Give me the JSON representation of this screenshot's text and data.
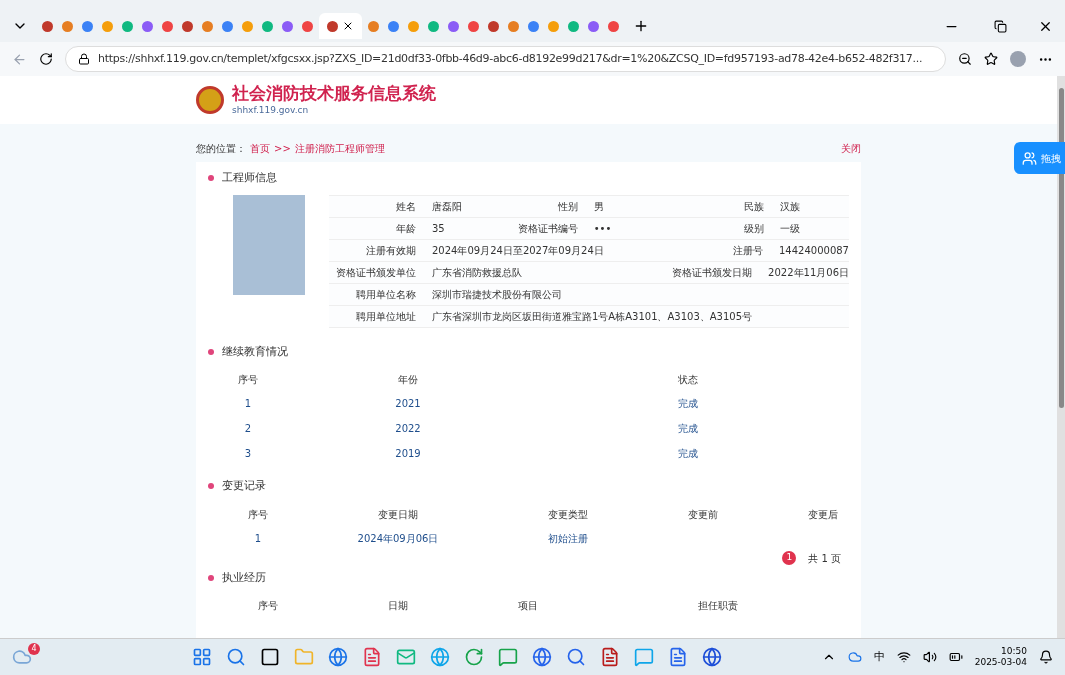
{
  "browser": {
    "tabs": [
      {
        "selected": false
      },
      {
        "selected": false
      },
      {
        "selected": false
      },
      {
        "selected": false
      },
      {
        "selected": false
      },
      {
        "selected": false
      },
      {
        "selected": false
      },
      {
        "selected": false
      },
      {
        "selected": false
      },
      {
        "selected": false
      },
      {
        "selected": false
      },
      {
        "selected": false
      },
      {
        "selected": false
      },
      {
        "selected": false
      },
      {
        "selected": true
      },
      {
        "selected": false
      },
      {
        "selected": false
      },
      {
        "selected": false
      },
      {
        "selected": false
      },
      {
        "selected": false
      },
      {
        "selected": false
      },
      {
        "selected": false
      },
      {
        "selected": false
      },
      {
        "selected": false
      },
      {
        "selected": false
      },
      {
        "selected": false
      },
      {
        "selected": false
      },
      {
        "selected": false
      }
    ],
    "url": "https://shhxf.119.gov.cn/templet/xfgcsxx.jsp?ZXS_ID=21d0df33-0fbb-46d9-abc6-d8192e99d217&dr=1%20&ZCSQ_ID=fd957193-ad78-42e4-b652-482f317..."
  },
  "site": {
    "title": "社会消防技术服务信息系统",
    "domain": "shhxf.119.gov.cn"
  },
  "breadcrumb": {
    "label": "您的位置：",
    "items": [
      "首页",
      ">>",
      "注册消防工程师管理"
    ],
    "close": "关闭"
  },
  "float_button": {
    "label": "拖拽"
  },
  "engineer": {
    "heading": "工程师信息",
    "rows": [
      [
        {
          "label": "姓名",
          "value": "唐磊阳"
        },
        {
          "label": "性别",
          "value": "男"
        },
        {
          "label": "民族",
          "value": "汉族"
        }
      ],
      [
        {
          "label": "年龄",
          "value": "35"
        },
        {
          "label": "资格证书编号",
          "value": "•••"
        },
        {
          "label": "级别",
          "value": "一级"
        }
      ],
      [
        {
          "label": "注册有效期",
          "value": "2024年09月24日至2027年09月24日"
        },
        {
          "label": "注册号",
          "value": "14424000087"
        }
      ],
      [
        {
          "label": "资格证书颁发单位",
          "value": "广东省消防救援总队"
        },
        {
          "label": "资格证书颁发日期",
          "value": "2022年11月06日"
        }
      ],
      [
        {
          "label": "聘用单位名称",
          "value": "深圳市瑞捷技术股份有限公司"
        }
      ],
      [
        {
          "label": "聘用单位地址",
          "value": "广东省深圳市龙岗区坂田街道雅宝路1号A栋A3101、A3103、A3105号"
        }
      ]
    ]
  },
  "education": {
    "heading": "继续教育情况",
    "columns": [
      "序号",
      "年份",
      "状态"
    ],
    "rows": [
      [
        "1",
        "2021",
        "完成"
      ],
      [
        "2",
        "2022",
        "完成"
      ],
      [
        "3",
        "2019",
        "完成"
      ]
    ]
  },
  "changes": {
    "heading": "变更记录",
    "columns": [
      "序号",
      "变更日期",
      "变更类型",
      "变更前",
      "变更后"
    ],
    "rows": [
      [
        "1",
        "2024年09月06日",
        "初始注册"
      ]
    ],
    "pager": {
      "current": "1",
      "total": "共 1 页"
    }
  },
  "experience": {
    "heading": "执业经历",
    "columns": [
      "序号",
      "日期",
      "项目",
      "担任职责"
    ]
  },
  "taskbar": {
    "badge": "4",
    "ime": "中",
    "time": "10:50",
    "date": "2025-03-04"
  }
}
